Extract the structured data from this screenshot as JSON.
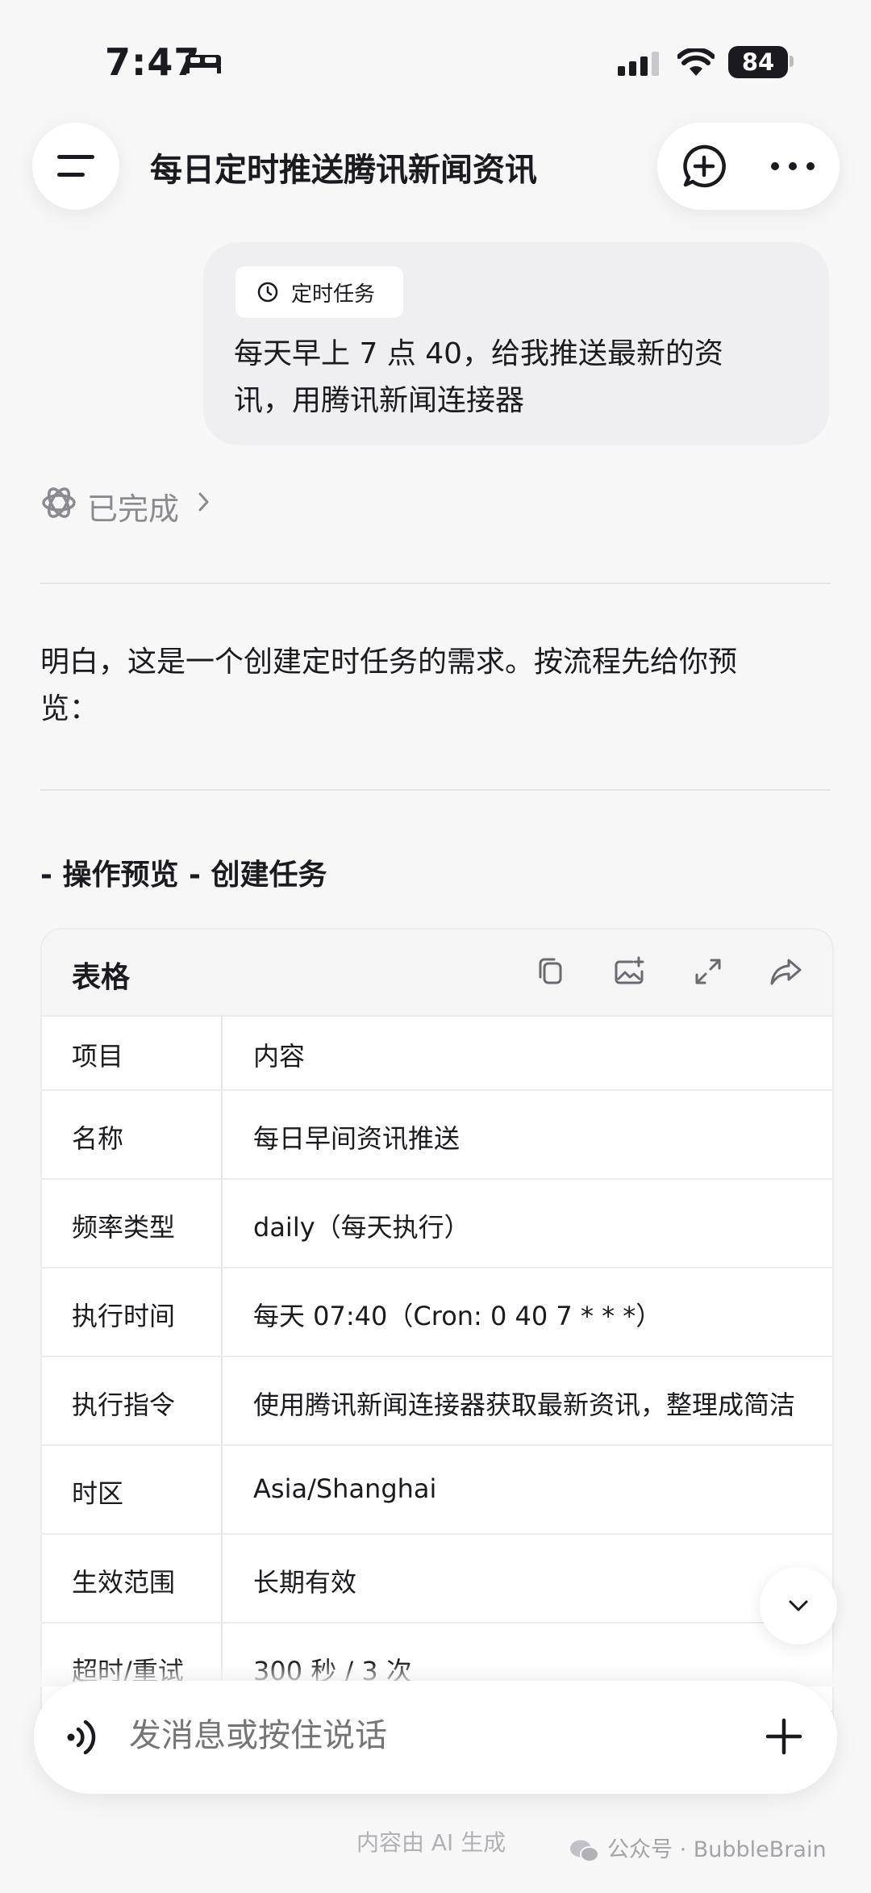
{
  "status_bar": {
    "time": "7:47",
    "battery": "84"
  },
  "header": {
    "title": "每日定时推送腾讯新闻资讯"
  },
  "user_message": {
    "tag": "定时任务",
    "text_line1": "每天早上 7 点 40，给我推送最新的资",
    "text_line2": "讯，用腾讯新闻连接器"
  },
  "status": {
    "label": "已完成"
  },
  "assistant": {
    "intro_line1": "明白，这是一个创建定时任务的需求。按流程先给你预",
    "intro_line2": "览：",
    "section_heading": "- 操作预览 - 创建任务"
  },
  "table": {
    "title": "表格",
    "tools": [
      "copy-icon",
      "image-icon",
      "expand-icon",
      "share-icon"
    ],
    "headers": [
      "项目",
      "内容"
    ],
    "rows": [
      [
        "名称",
        "每日早间资讯推送"
      ],
      [
        "频率类型",
        "daily（每天执行）"
      ],
      [
        "执行时间",
        "每天 07:40（Cron: 0 40 7 * * *）"
      ],
      [
        "执行指令",
        "使用腾讯新闻连接器获取最新资讯，整理成简洁"
      ],
      [
        "时区",
        "Asia/Shanghai"
      ],
      [
        "生效范围",
        "长期有效"
      ],
      [
        "超时/重试",
        "300 秒 / 3 次"
      ]
    ]
  },
  "input": {
    "placeholder": "发消息或按住说话"
  },
  "footer": {
    "note": "内容由 AI 生成",
    "watermark": "公众号 · BubbleBrain"
  }
}
